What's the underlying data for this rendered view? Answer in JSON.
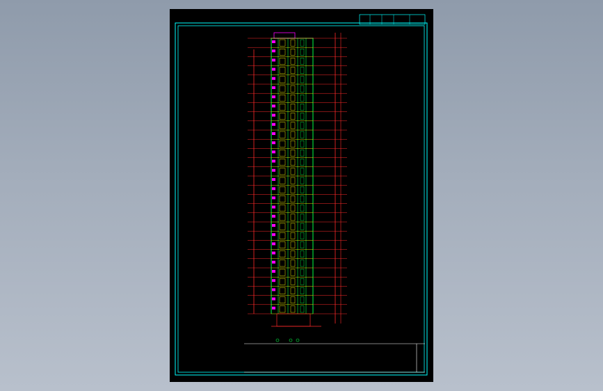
{
  "app": {
    "name": "",
    "view": "building-elevation"
  },
  "drawing": {
    "floor_count": 30,
    "left_labels": [],
    "right_labels": [],
    "title_block_text": "",
    "caption_text": "",
    "colors": {
      "background": "#000000",
      "frame": "#00ffff",
      "structure": "#00ff44",
      "dimension": "#ff2a2a",
      "accent": "#ff00ff",
      "text": "#ffffff",
      "window": "#ffff00"
    }
  }
}
